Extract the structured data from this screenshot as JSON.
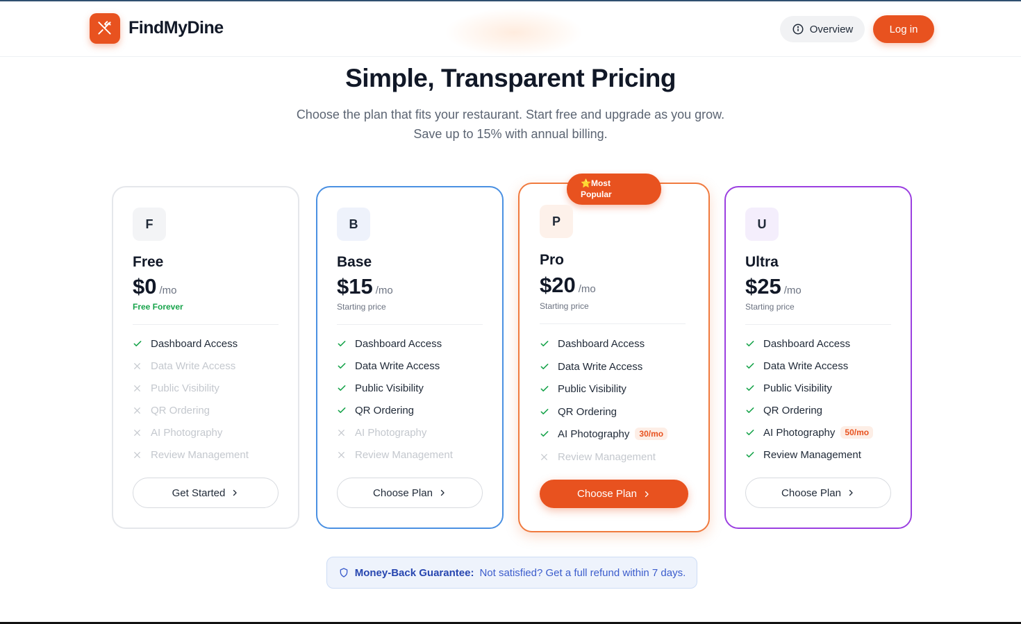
{
  "header": {
    "brand": "FindMyDine",
    "overview_label": "Overview",
    "login_label": "Log in"
  },
  "hero": {
    "title": "Simple, Transparent Pricing",
    "subtitle_line1": "Choose the plan that fits your restaurant. Start free and upgrade as you grow.",
    "subtitle_line2": "Save up to 15% with annual billing."
  },
  "badge": {
    "line1": "Most",
    "line2": "Popular",
    "icon": "star-icon"
  },
  "plans": [
    {
      "letter": "F",
      "name": "Free",
      "price": "$0",
      "per": "/mo",
      "note": "Free Forever",
      "features": [
        {
          "label": "Dashboard Access",
          "included": true
        },
        {
          "label": "Data Write Access",
          "included": false
        },
        {
          "label": "Public Visibility",
          "included": false
        },
        {
          "label": "QR Ordering",
          "included": false
        },
        {
          "label": "AI Photography",
          "included": false
        },
        {
          "label": "Review Management",
          "included": false
        }
      ],
      "cta": "Get Started"
    },
    {
      "letter": "B",
      "name": "Base",
      "price": "$15",
      "per": "/mo",
      "note": "Starting price",
      "features": [
        {
          "label": "Dashboard Access",
          "included": true
        },
        {
          "label": "Data Write Access",
          "included": true
        },
        {
          "label": "Public Visibility",
          "included": true
        },
        {
          "label": "QR Ordering",
          "included": true
        },
        {
          "label": "AI Photography",
          "included": false
        },
        {
          "label": "Review Management",
          "included": false
        }
      ],
      "cta": "Choose Plan"
    },
    {
      "letter": "P",
      "name": "Pro",
      "price": "$20",
      "per": "/mo",
      "note": "Starting price",
      "features": [
        {
          "label": "Dashboard Access",
          "included": true
        },
        {
          "label": "Data Write Access",
          "included": true
        },
        {
          "label": "Public Visibility",
          "included": true
        },
        {
          "label": "QR Ordering",
          "included": true
        },
        {
          "label": "AI Photography",
          "included": true,
          "extra": "30/mo"
        },
        {
          "label": "Review Management",
          "included": false
        }
      ],
      "cta": "Choose Plan"
    },
    {
      "letter": "U",
      "name": "Ultra",
      "price": "$25",
      "per": "/mo",
      "note": "Starting price",
      "features": [
        {
          "label": "Dashboard Access",
          "included": true
        },
        {
          "label": "Data Write Access",
          "included": true
        },
        {
          "label": "Public Visibility",
          "included": true
        },
        {
          "label": "QR Ordering",
          "included": true
        },
        {
          "label": "AI Photography",
          "included": true,
          "extra": "50/mo"
        },
        {
          "label": "Review Management",
          "included": true
        }
      ],
      "cta": "Choose Plan"
    }
  ],
  "guarantee": {
    "bold": "Money-Back Guarantee:",
    "text": "Not satisfied? Get a full refund within 7 days."
  },
  "colors": {
    "accent": "#e8521f",
    "base_border": "#4a90e2",
    "pro_border": "#f07a3e",
    "ultra_border": "#9b3fe0",
    "check": "#16a34a"
  }
}
